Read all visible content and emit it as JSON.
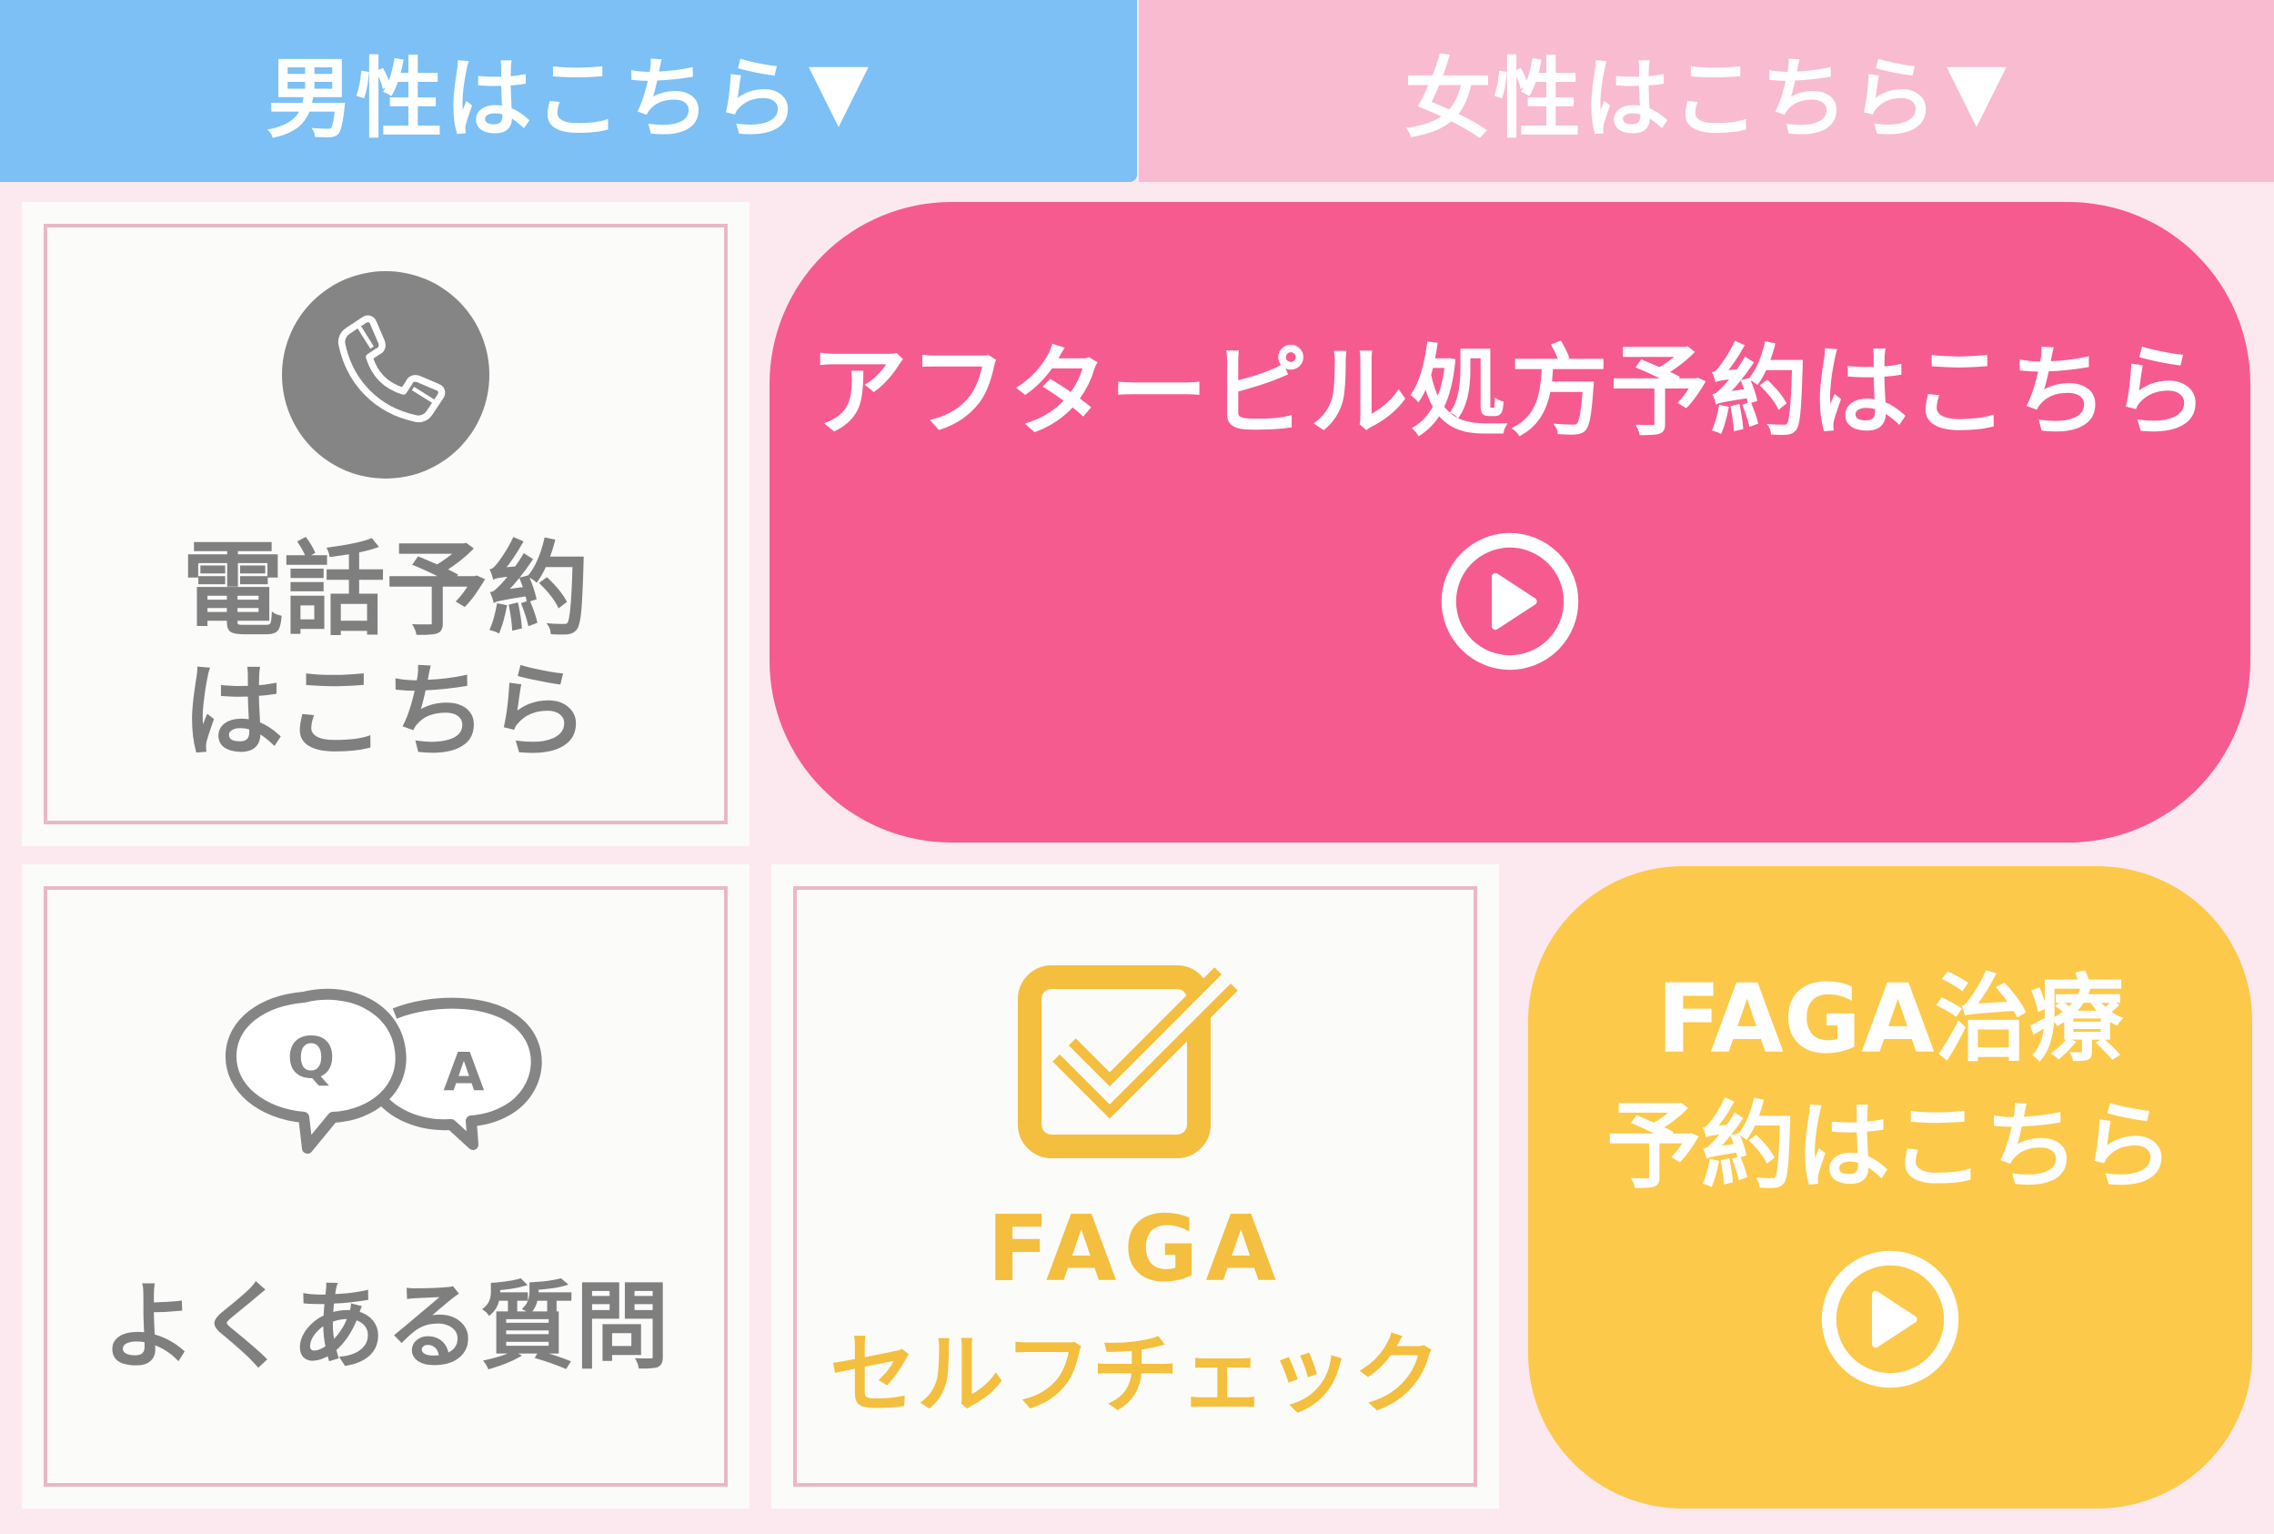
{
  "tabs": {
    "men": {
      "label": "男性はこちら",
      "marker": "▼"
    },
    "women": {
      "label": "女性はこちら",
      "marker": "▼"
    }
  },
  "phone_card": {
    "line1": "電話予約",
    "line2": "はこちら",
    "icon": "phone-handset-icon"
  },
  "after_pill_button": {
    "label": "アフターピル処方予約はこちら",
    "icon": "play-circle-icon"
  },
  "faq_card": {
    "label": "よくある質問",
    "icon": "qa-speech-bubbles-icon",
    "bubble_q": "Q",
    "bubble_a": "A"
  },
  "self_check_card": {
    "title": "FAGA",
    "subtitle": "セルフチェック",
    "icon": "checkbox-icon"
  },
  "faga_button": {
    "line1": "FAGA治療",
    "line2": "予約はこちら",
    "icon": "play-circle-icon"
  },
  "colors": {
    "men_tab": "#7cc0f5",
    "women_tab": "#f9bbd0",
    "pink_button": "#f65b8f",
    "yellow_button": "#fdc94a",
    "card_frame": "#eab8c5",
    "gray_text": "#7f7f7f",
    "yellow_text": "#f4bf3f"
  }
}
